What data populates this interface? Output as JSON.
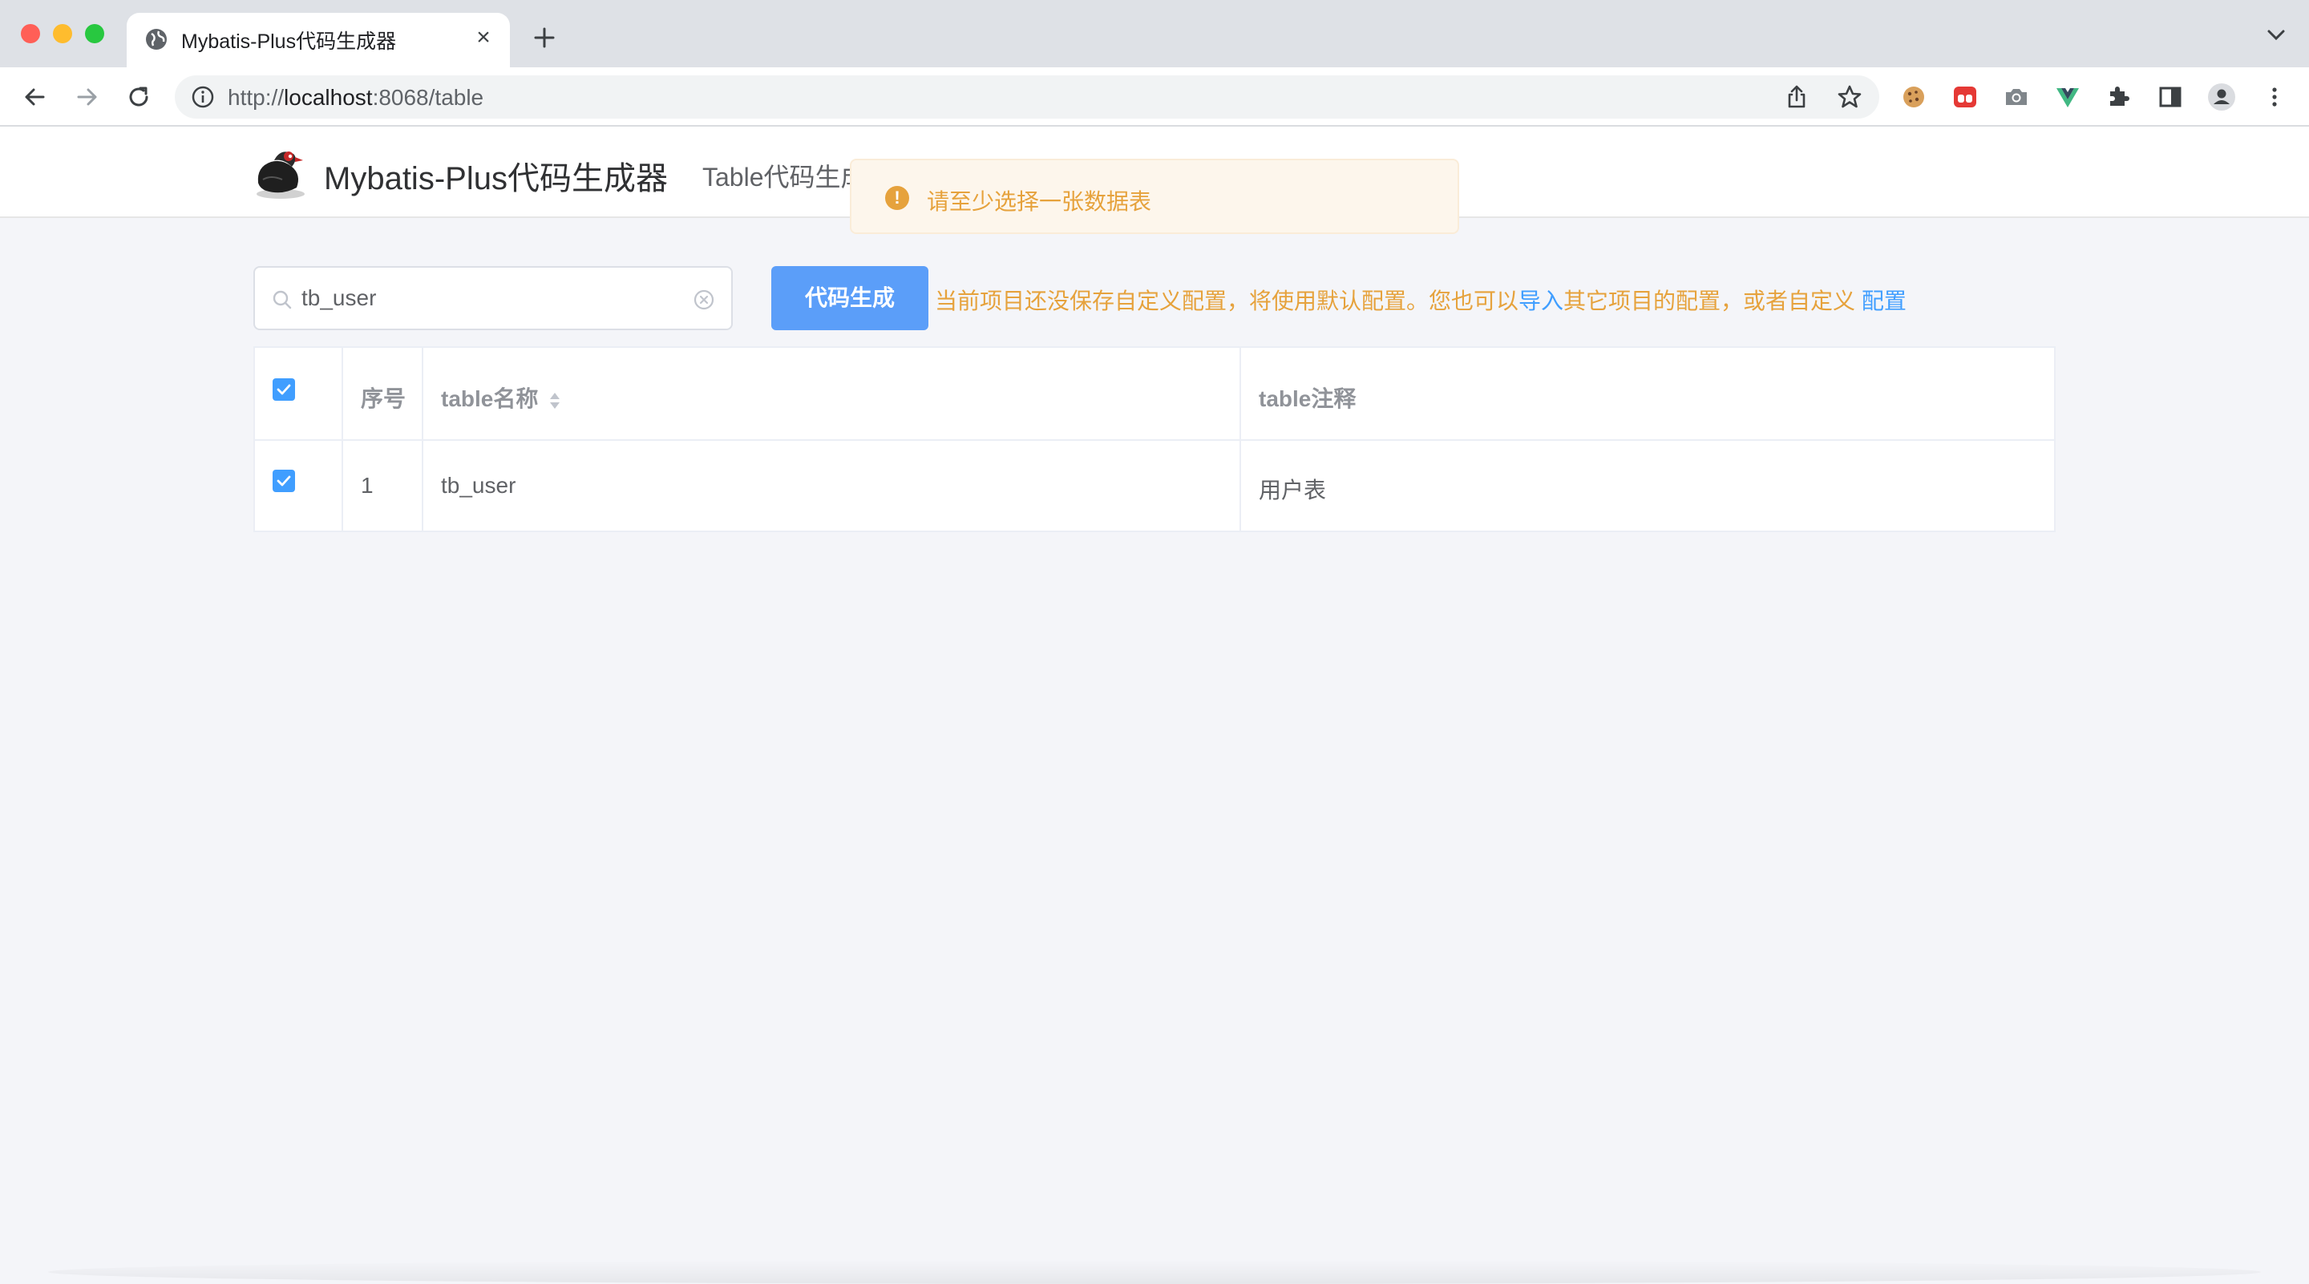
{
  "browser": {
    "tab_title": "Mybatis-Plus代码生成器",
    "url_prefix": "http://",
    "url_host": "localhost",
    "url_rest": ":8068/table"
  },
  "header": {
    "app_title": "Mybatis-Plus代码生成器",
    "nav_item": "Table代码生成"
  },
  "toast": {
    "message": "请至少选择一张数据表",
    "color": "#e6a23c"
  },
  "search": {
    "value": "tb_user"
  },
  "actions": {
    "generate_label": "代码生成",
    "hint_part1": "当前项目还没保存自定义配置，将使用默认配置。您也可以",
    "hint_link_import": "导入",
    "hint_part2": "其它项目的配置，或者自定义 ",
    "hint_link_config": "配置"
  },
  "table": {
    "columns": [
      "序号",
      "table名称",
      "table注释"
    ],
    "rows": [
      {
        "index": "1",
        "name": "tb_user",
        "comment": "用户表",
        "checked": true
      }
    ],
    "header_checked": true
  },
  "colors": {
    "primary": "#409eff",
    "button": "#5b9ef9",
    "warning": "#e6a23c"
  }
}
